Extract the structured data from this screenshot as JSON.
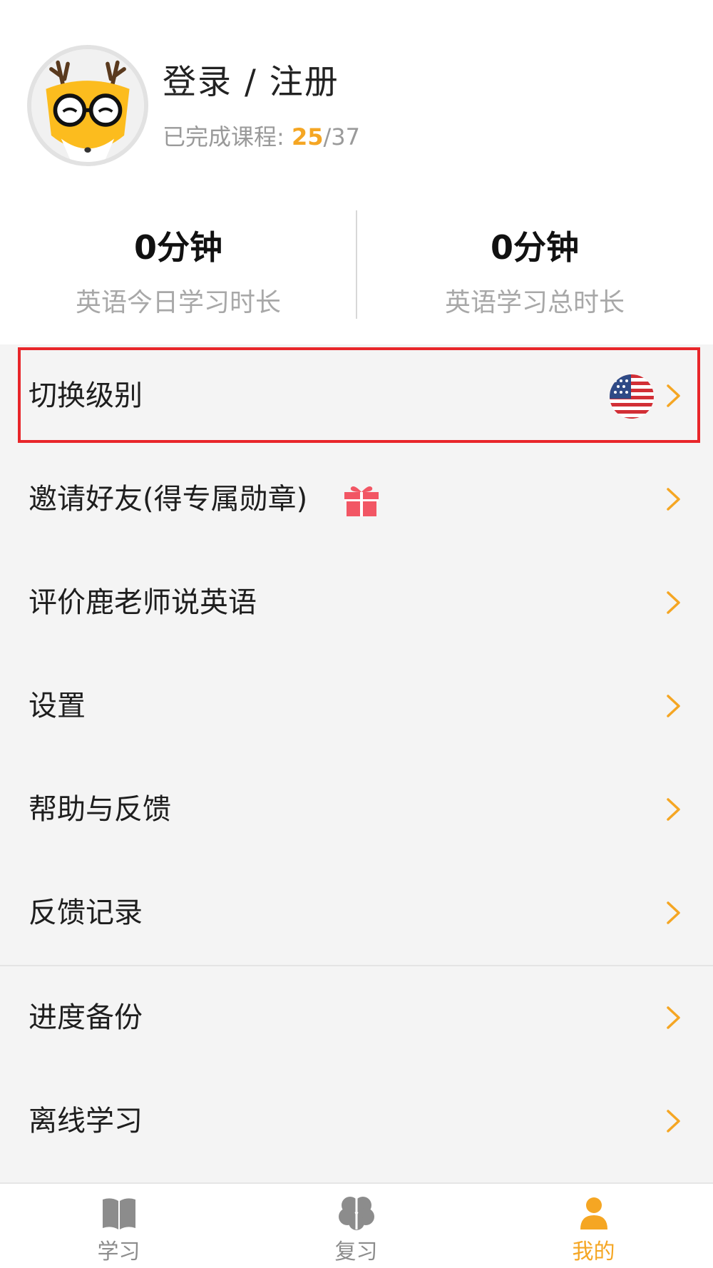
{
  "profile": {
    "login_text": "登录 / 注册",
    "progress_label": "已完成课程: ",
    "completed": "25",
    "separator": "/",
    "total": "37"
  },
  "stats": [
    {
      "value": "0分钟",
      "label": "英语今日学习时长"
    },
    {
      "value": "0分钟",
      "label": "英语学习总时长"
    }
  ],
  "menu": {
    "items": [
      {
        "label": "切换级别",
        "accessory": "us-flag-icon",
        "highlighted": true
      },
      {
        "label": "邀请好友(得专属勋章)",
        "accessory": "gift-icon"
      },
      {
        "label": "评价鹿老师说英语"
      },
      {
        "label": "设置"
      },
      {
        "label": "帮助与反馈"
      },
      {
        "label": "反馈记录"
      },
      {
        "label": "进度备份"
      },
      {
        "label": "离线学习"
      }
    ]
  },
  "tabbar": {
    "tabs": [
      {
        "label": "学习",
        "icon": "book-icon"
      },
      {
        "label": "复习",
        "icon": "brain-icon"
      },
      {
        "label": "我的",
        "icon": "profile-icon",
        "active": true
      }
    ]
  },
  "colors": {
    "accent": "#f5a623",
    "highlight_border": "#e8262a",
    "background": "#f4f4f4",
    "chevron": "#f5a623"
  }
}
